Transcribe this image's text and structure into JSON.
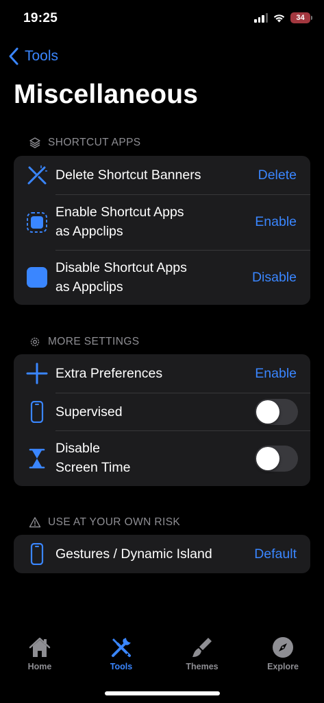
{
  "status": {
    "time": "19:25",
    "battery": "34"
  },
  "nav": {
    "back_label": "Tools"
  },
  "page": {
    "title": "Miscellaneous"
  },
  "sections": [
    {
      "header": "SHORTCUT APPS",
      "header_icon": "stack-icon",
      "rows": [
        {
          "label": "Delete Shortcut Banners",
          "action": "Delete",
          "icon": "wand-icon"
        },
        {
          "label_line1": "Enable Shortcut Apps",
          "label_line2": "as Appclips",
          "action": "Enable",
          "icon": "dashed-square-icon"
        },
        {
          "label_line1": "Disable Shortcut Apps",
          "label_line2": "as Appclips",
          "action": "Disable",
          "icon": "filled-square-icon"
        }
      ]
    },
    {
      "header": "MORE SETTINGS",
      "header_icon": "gear-icon",
      "rows": [
        {
          "label": "Extra Preferences",
          "action": "Enable",
          "icon": "plus-icon"
        },
        {
          "label": "Supervised",
          "toggle": false,
          "icon": "iphone-icon"
        },
        {
          "label_line1": "Disable",
          "label_line2": "Screen Time",
          "toggle": false,
          "icon": "hourglass-icon"
        }
      ]
    },
    {
      "header": "USE AT YOUR OWN RISK",
      "header_icon": "warning-icon",
      "rows": [
        {
          "label": "Gestures / Dynamic Island",
          "action": "Default",
          "icon": "iphone-icon"
        }
      ]
    }
  ],
  "tabbar": {
    "tabs": [
      {
        "label": "Home",
        "icon": "house-icon",
        "active": false
      },
      {
        "label": "Tools",
        "icon": "tools-icon",
        "active": true
      },
      {
        "label": "Themes",
        "icon": "paintbrush-icon",
        "active": false
      },
      {
        "label": "Explore",
        "icon": "compass-icon",
        "active": false
      }
    ]
  },
  "colors": {
    "accent": "#3a86ff",
    "background": "#000000",
    "card": "#1c1c1e",
    "secondary_text": "#8e8e93"
  }
}
